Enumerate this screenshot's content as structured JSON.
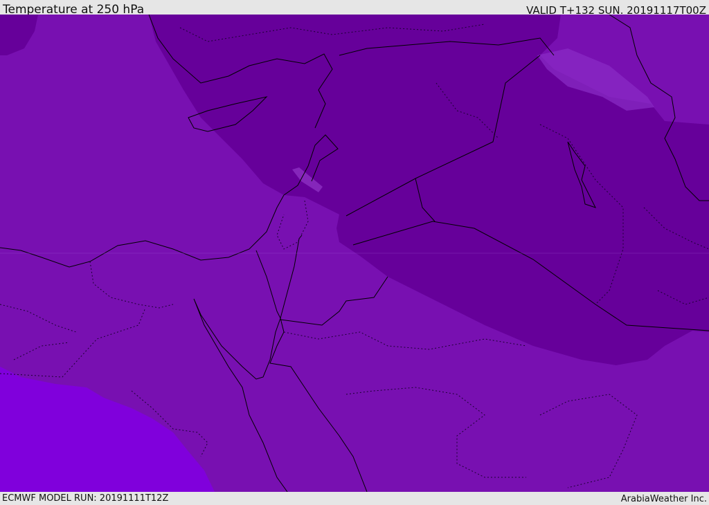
{
  "header": {
    "title": "Temperature at 250 hPa",
    "valid_time": "VALID T+132 SUN. 20191117T00Z"
  },
  "footer": {
    "model_run": "ECMWF MODEL RUN: 20191111T12Z",
    "credit": "ArabiaWeather Inc."
  },
  "colors": {
    "field_mid": "#7810b1",
    "field_cold": "#66009a",
    "field_warm": "#8000dc",
    "field_pale": "#9a3fd0",
    "coastline": "#000000",
    "border_dotted": "#1a0030"
  }
}
